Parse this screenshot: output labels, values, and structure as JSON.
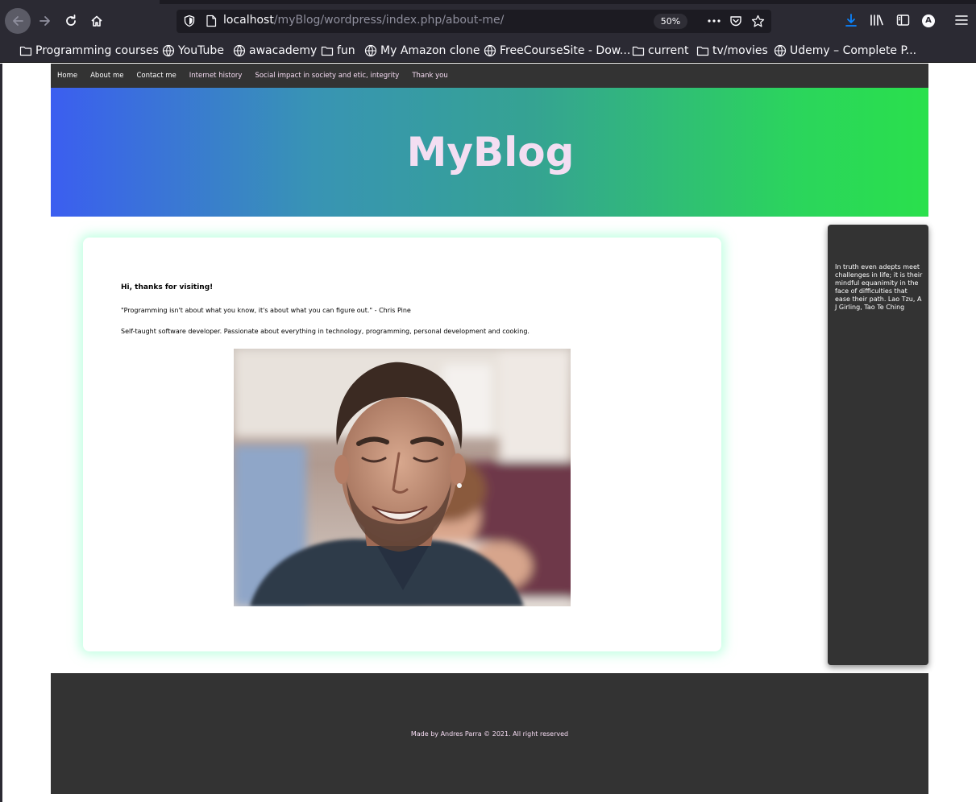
{
  "browser": {
    "url_host": "localhost",
    "url_path": "/myBlog/wordpress/index.php/about-me/",
    "zoom": "50%",
    "bookmarks": [
      {
        "label": "Programming courses",
        "icon": "folder-icon"
      },
      {
        "label": "YouTube",
        "icon": "globe-icon"
      },
      {
        "label": "awacademy",
        "icon": "globe-icon"
      },
      {
        "label": "fun",
        "icon": "folder-icon"
      },
      {
        "label": "My Amazon clone",
        "icon": "globe-icon"
      },
      {
        "label": "FreeCourseSite - Dow...",
        "icon": "globe-icon"
      },
      {
        "label": "current",
        "icon": "folder-icon"
      },
      {
        "label": "tv/movies",
        "icon": "folder-icon"
      },
      {
        "label": "Udemy – Complete P...",
        "icon": "globe-icon"
      }
    ],
    "account_initial": "A"
  },
  "site": {
    "nav": [
      {
        "label": "Home"
      },
      {
        "label": "About me"
      },
      {
        "label": "Contact me"
      },
      {
        "label": "Internet history"
      },
      {
        "label": "Social impact in society and etic, integrity"
      },
      {
        "label": "Thank you"
      }
    ],
    "title": "MyBlog",
    "greeting": "Hi, thanks for visiting!",
    "quote": "\"Programming isn't about what you know, it's about what you can figure out.\" - Chris Pine",
    "bio": "Self-taught software developer. Passionate about everything in technology, programming, personal development and cooking.",
    "sidebar_quote": "In truth even adepts meet challenges in life; it is their mindful equanimity in the face of difficulties that ease their path. Lao Tzu, A J Girling, Tao Te Ching",
    "footer": "Made by Andres Parra © 2021. All right reserved"
  },
  "colors": {
    "chrome": "#2b2a33",
    "url_field": "#1c1b22",
    "nav_bg": "#333333",
    "title_color": "#f3def2",
    "gradient_start": "#3b5ef0",
    "gradient_end": "#2ae04c",
    "card_glow": "#8cffc8",
    "download_accent": "#0a84ff"
  }
}
